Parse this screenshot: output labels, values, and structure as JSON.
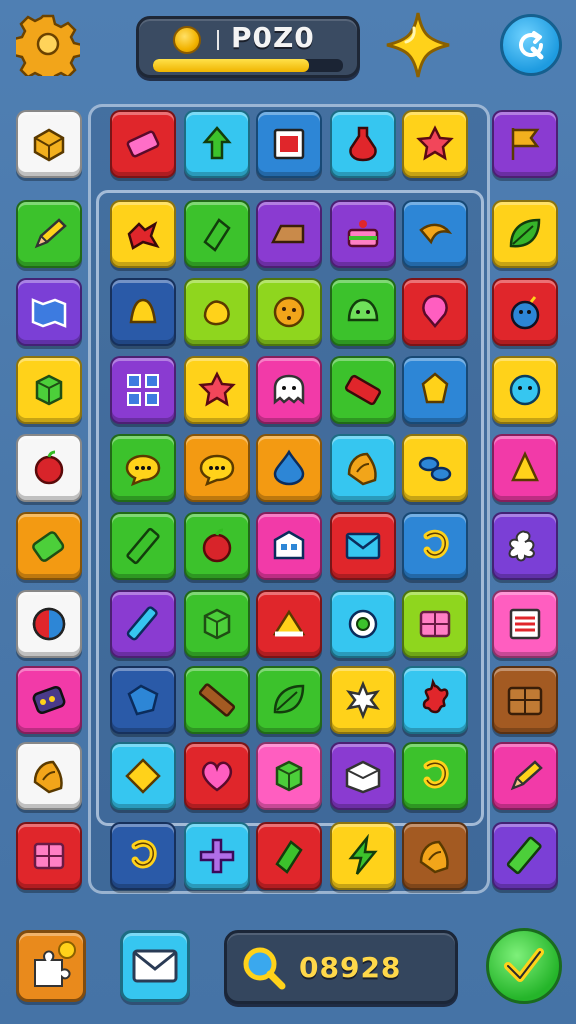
{
  "header": {
    "score_label": "P0Z0",
    "progress": 0.82,
    "settings_icon": "gear-icon",
    "star_icon": "sparkle-star-icon",
    "refresh_icon": "refresh-icon"
  },
  "footer": {
    "search_value": "08928",
    "left_button_icon": "puzzle-piece-icon",
    "mail_button_icon": "mail-icon",
    "search_icon": "magnifier-icon",
    "go_button_icon": "arrow-check-icon"
  },
  "colors": {
    "red": "#e0262b",
    "cyan": "#36c6f0",
    "blue": "#2d86d6",
    "yellow": "#ffd21a",
    "purple": "#8a3bd1",
    "green": "#3cc22c",
    "lime": "#8fd61e",
    "magenta": "#f23aa8",
    "orange": "#f39a12",
    "white": "#f7f7f7",
    "navy": "#2a5aa8",
    "brown": "#a35a22",
    "violet": "#7b3fd6",
    "pink": "#ff5ec0"
  },
  "left_column": [
    {
      "color": "white",
      "icon": "box-icon"
    },
    {
      "color": "green",
      "icon": "pencil-icon"
    },
    {
      "color": "violet",
      "icon": "map-icon"
    },
    {
      "color": "yellow",
      "icon": "cube-icon"
    },
    {
      "color": "white",
      "icon": "apple-icon"
    },
    {
      "color": "orange",
      "icon": "battery-icon"
    },
    {
      "color": "white",
      "icon": "ball-icon"
    },
    {
      "color": "magenta",
      "icon": "gadget-icon"
    },
    {
      "color": "white",
      "icon": "shell-icon"
    },
    {
      "color": "red",
      "icon": "crate-icon"
    }
  ],
  "right_column": [
    {
      "color": "purple",
      "icon": "flag-icon"
    },
    {
      "color": "yellow",
      "icon": "leaf-icon"
    },
    {
      "color": "red",
      "icon": "bomb-icon"
    },
    {
      "color": "yellow",
      "icon": "face-icon"
    },
    {
      "color": "magenta",
      "icon": "cone-icon"
    },
    {
      "color": "violet",
      "icon": "flower-icon"
    },
    {
      "color": "pink",
      "icon": "card-icon"
    },
    {
      "color": "brown",
      "icon": "chest-icon"
    },
    {
      "color": "magenta",
      "icon": "pencil-icon"
    },
    {
      "color": "violet",
      "icon": "ruler-icon"
    }
  ],
  "top_row": [
    {
      "color": "red",
      "icon": "eraser-icon"
    },
    {
      "color": "cyan",
      "icon": "arrow-up-icon"
    },
    {
      "color": "blue",
      "icon": "frame-icon"
    },
    {
      "color": "cyan",
      "icon": "potion-icon"
    },
    {
      "color": "yellow",
      "icon": "star-icon"
    }
  ],
  "board": [
    [
      {
        "color": "yellow",
        "icon": "bird-icon"
      },
      {
        "color": "green",
        "icon": "gem-icon"
      },
      {
        "color": "purple",
        "icon": "cake-slice-icon"
      },
      {
        "color": "purple",
        "icon": "cake-icon"
      },
      {
        "color": "blue",
        "icon": "banana-icon"
      }
    ],
    [
      {
        "color": "navy",
        "icon": "bell-icon"
      },
      {
        "color": "lime",
        "icon": "blob-icon"
      },
      {
        "color": "lime",
        "icon": "cookie-icon"
      },
      {
        "color": "green",
        "icon": "slime-icon"
      },
      {
        "color": "red",
        "icon": "balloon-icon"
      }
    ],
    [
      {
        "color": "purple",
        "icon": "grid-icon"
      },
      {
        "color": "yellow",
        "icon": "star-icon"
      },
      {
        "color": "magenta",
        "icon": "ghost-icon"
      },
      {
        "color": "green",
        "icon": "brick-icon"
      },
      {
        "color": "blue",
        "icon": "crystal-icon"
      }
    ],
    [
      {
        "color": "green",
        "icon": "chat-icon"
      },
      {
        "color": "orange",
        "icon": "chat-icon"
      },
      {
        "color": "orange",
        "icon": "drop-icon"
      },
      {
        "color": "cyan",
        "icon": "shell-icon"
      },
      {
        "color": "yellow",
        "icon": "pebbles-icon"
      }
    ],
    [
      {
        "color": "green",
        "icon": "bar-icon"
      },
      {
        "color": "green",
        "icon": "apple-icon"
      },
      {
        "color": "magenta",
        "icon": "house-icon"
      },
      {
        "color": "red",
        "icon": "mail-icon"
      },
      {
        "color": "blue",
        "icon": "hook-icon"
      }
    ],
    [
      {
        "color": "purple",
        "icon": "pen-icon"
      },
      {
        "color": "green",
        "icon": "cube-icon"
      },
      {
        "color": "red",
        "icon": "cheese-icon"
      },
      {
        "color": "cyan",
        "icon": "gear-ring-icon"
      },
      {
        "color": "lime",
        "icon": "crate-icon"
      }
    ],
    [
      {
        "color": "navy",
        "icon": "block-icon"
      },
      {
        "color": "green",
        "icon": "stick-icon"
      },
      {
        "color": "green",
        "icon": "leaf-icon"
      },
      {
        "color": "yellow",
        "icon": "star-splash-icon"
      },
      {
        "color": "cyan",
        "icon": "splat-icon"
      }
    ],
    [
      {
        "color": "cyan",
        "icon": "diamond-icon"
      },
      {
        "color": "red",
        "icon": "heart-icon"
      },
      {
        "color": "pink",
        "icon": "cube-icon"
      },
      {
        "color": "purple",
        "icon": "envelope-box-icon"
      },
      {
        "color": "green",
        "icon": "hook-icon"
      }
    ],
    [
      {
        "color": "navy",
        "icon": "hook-icon"
      },
      {
        "color": "cyan",
        "icon": "cross-icon"
      },
      {
        "color": "red",
        "icon": "gem-icon"
      },
      {
        "color": "yellow",
        "icon": "bolt-icon"
      },
      {
        "color": "brown",
        "icon": "shell-icon"
      }
    ]
  ]
}
